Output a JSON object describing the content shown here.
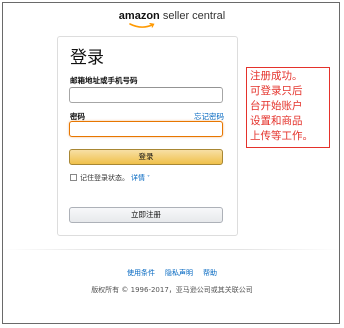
{
  "logo": {
    "brand": "amazon",
    "product": " seller central"
  },
  "signin": {
    "title": "登录",
    "email_label": "邮箱地址或手机号码",
    "email_value": "",
    "password_label": "密码",
    "password_value": "",
    "forgot_password": "忘记密码",
    "submit_label": "登录",
    "remember_label": "记住登录状态。",
    "details_link": "详情",
    "register_label": "立即注册"
  },
  "note": {
    "lines": [
      "注册成功。",
      "可登录只后",
      "台开始账户",
      "设置和商品",
      "上传等工作。"
    ]
  },
  "footer": {
    "links": [
      "使用条件",
      "隐私声明",
      "帮助"
    ],
    "copyright": "版权所有 © 1996-2017，亚马逊公司或其关联公司"
  },
  "colors": {
    "link": "#0066c0",
    "note": "#e4322b",
    "primary_button": "#f0c14b",
    "focus_border": "#e77600",
    "logo_smile": "#ff9900"
  }
}
